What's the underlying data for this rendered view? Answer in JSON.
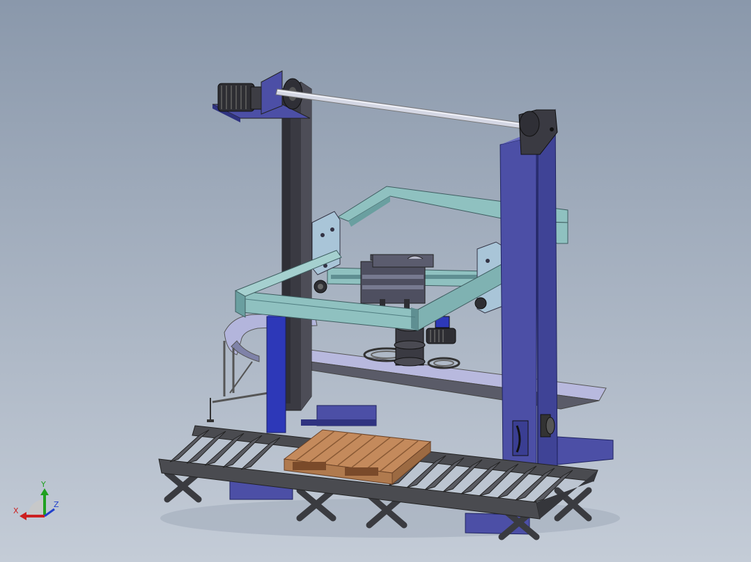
{
  "viewport": {
    "background_top": "#8a98ab",
    "background_bottom": "#c4ccd7"
  },
  "model": {
    "colors": {
      "frame_blue": "#4c4fa6",
      "frame_blue_dark": "#2f3380",
      "belt_dark": "#3a3a40",
      "carriage_teal": "#8fc1c0",
      "carriage_teal_dark": "#5f8f92",
      "conveyor_gray": "#4a4b50",
      "pallet_wood": "#c48a5c",
      "rail_lavender": "#b3b5dc",
      "shaft_silver": "#cfd3df"
    }
  },
  "triad": {
    "x_label": "X",
    "y_label": "Y",
    "z_label": "Z",
    "x_color": "#cc2020",
    "y_color": "#20a020",
    "z_color": "#2040cc"
  }
}
